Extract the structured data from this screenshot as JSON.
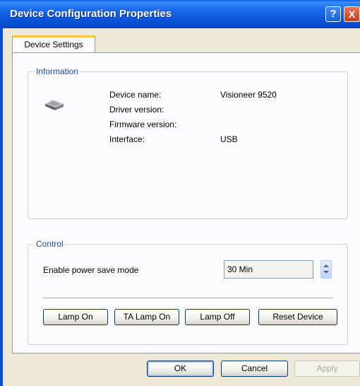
{
  "window": {
    "title": "Device Configuration Properties",
    "help_glyph": "?",
    "close_glyph": "X"
  },
  "tabs": [
    {
      "label": "Device Settings",
      "selected": true
    }
  ],
  "information": {
    "legend": "Information",
    "icon": "scanner-icon",
    "fields": [
      {
        "label": "Device name:",
        "value": "Visioneer 9520"
      },
      {
        "label": "Driver version:",
        "value": ""
      },
      {
        "label": "Firmware version:",
        "value": ""
      },
      {
        "label": "Interface:",
        "value": "USB"
      }
    ]
  },
  "control": {
    "legend": "Control",
    "power_save_label": "Enable power save mode",
    "power_save_value": "30 Min",
    "buttons": {
      "lamp_on": "Lamp On",
      "ta_lamp_on": "TA Lamp On",
      "lamp_off": "Lamp Off",
      "reset_device": "Reset Device"
    }
  },
  "footer": {
    "ok": "OK",
    "cancel": "Cancel",
    "apply": "Apply"
  }
}
